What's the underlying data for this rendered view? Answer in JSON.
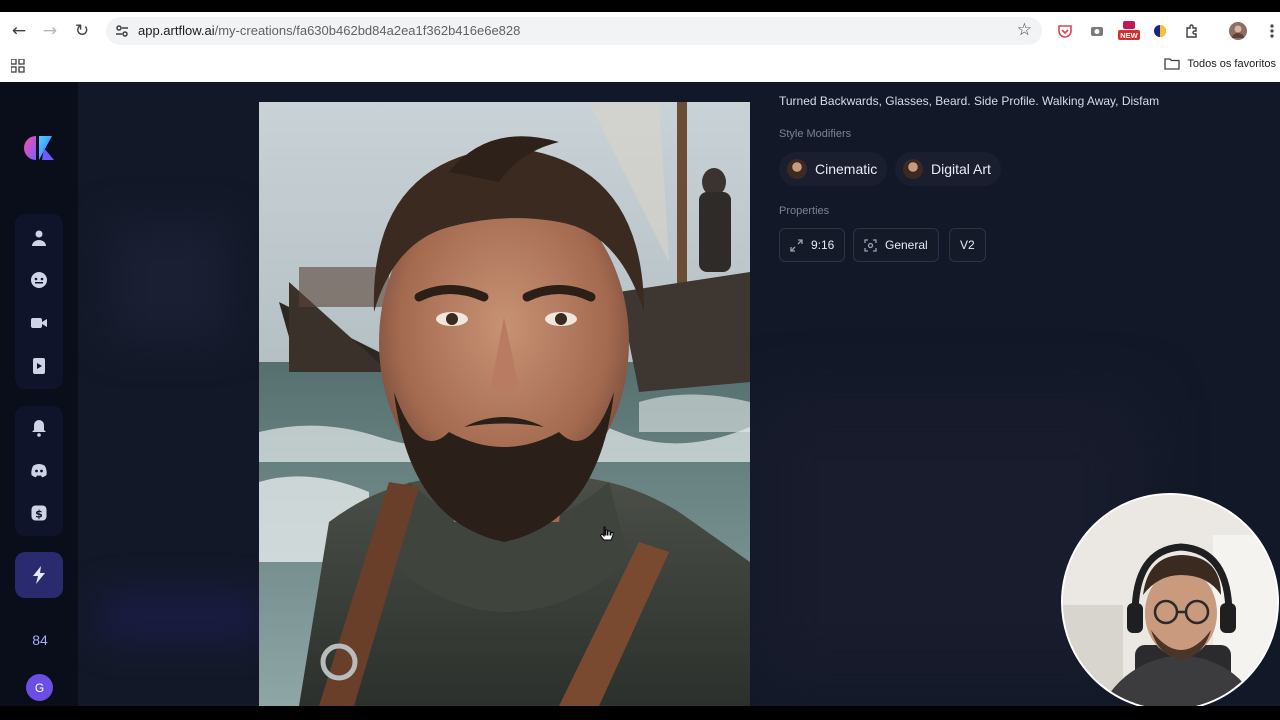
{
  "browser": {
    "url_host": "app.artflow.ai",
    "url_path": "/my-creations/fa630b462bd84a2ea1f362b416e6e828",
    "bookmarks_label": "Todos os favoritos",
    "new_badge": "NEW"
  },
  "sidebar": {
    "credits": "84",
    "avatar_letter": "G"
  },
  "details": {
    "prompt_truncated": "Turned Backwards, Glasses, Beard. Side Profile. Walking Away, Disfam",
    "style_modifiers_label": "Style Modifiers",
    "style_modifiers": [
      {
        "label": "Cinematic"
      },
      {
        "label": "Digital Art"
      }
    ],
    "properties_label": "Properties",
    "properties": {
      "ratio": "9:16",
      "mode": "General",
      "version": "V2"
    }
  },
  "colors": {
    "app_bg": "#0f1322",
    "sidebar_bg": "#0a0d1a",
    "accent": "#6b4ee6",
    "credits": "#a8abff"
  }
}
